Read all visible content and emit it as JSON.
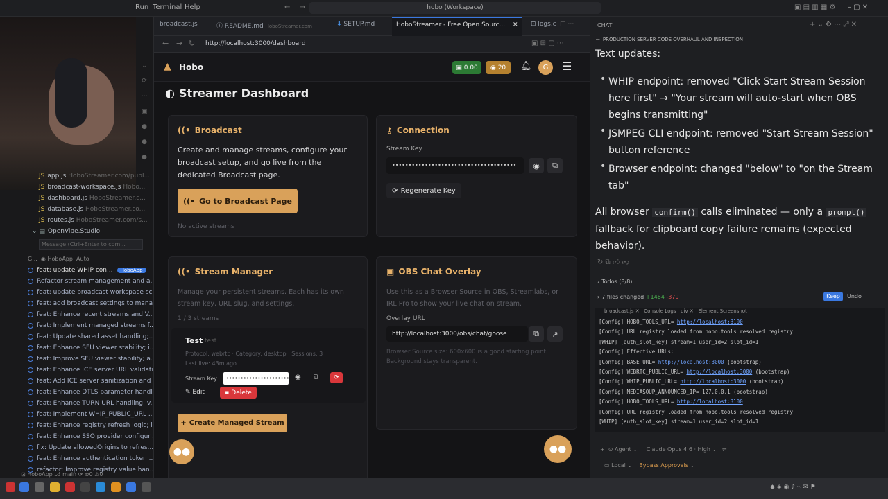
{
  "titlebar": {
    "menus": [
      "Run",
      "Terminal",
      "Help"
    ],
    "workspace": "hobo (Workspace)"
  },
  "explorer": {
    "files": [
      {
        "name": "app.js",
        "path": "HoboStreamer.com/publ..."
      },
      {
        "name": "broadcast-workspace.js",
        "path": "Hobo..."
      },
      {
        "name": "dashboard.js",
        "path": "HoboStreamer.c..."
      },
      {
        "name": "database.js",
        "path": "HoboStreamer.co..."
      },
      {
        "name": "routes.js",
        "path": "HoboStreamer.com/s..."
      }
    ],
    "repo": "OpenVibe.Studio",
    "message_placeholder": "Message (Ctrl+Enter to com...",
    "graph_label": "G...",
    "branch_label": "HoboApp",
    "auto_label": "Auto",
    "commits": [
      "feat: update WHIP con...",
      "Refactor stream management and a...",
      "feat: update broadcast workspace sc...",
      "feat: add broadcast settings to mana...",
      "feat: Enhance recent streams and V...",
      "feat: Implement managed streams f...",
      "feat: Update shared asset handling;...",
      "feat: Enhance SFU viewer stability; i...",
      "feat: Improve SFU viewer stability; a...",
      "feat: Enhance ICE server URL validati...",
      "feat: Add ICE server sanitization and ...",
      "feat: Enhance DTLS parameter handl...",
      "feat: Enhance TURN URL handling; v...",
      "feat: Implement WHIP_PUBLIC_URL ...",
      "feat: Enhance registry refresh logic; i...",
      "feat: Enhance SSO provider configur...",
      "fix: Update allowedOrigins to refres...",
      "feat: Enhance authentication token ...",
      "refactor: Improve registry value han..."
    ],
    "badge": "main"
  },
  "browser": {
    "tabs": [
      "broadcast.js",
      "README.md",
      "SETUP.md",
      "HoboStreamer - Free Open Sourc...",
      "logs.c"
    ],
    "tab_subs": [
      "",
      "HoboStreamer.com",
      "",
      ""
    ],
    "url": "http://localhost:3000/dashboard",
    "app": {
      "brand": "Hobo",
      "balance": "0.00",
      "coins": "20",
      "avatar_letter": "G",
      "page_title": "Streamer Dashboard",
      "broadcast": {
        "title": "Broadcast",
        "desc": "Create and manage streams, configure your broadcast setup, and go live from the dedicated Broadcast page.",
        "button": "Go to Broadcast Page",
        "empty": "No active streams"
      },
      "connection": {
        "title": "Connection",
        "key_label": "Stream Key",
        "key_value": "••••••••••••••••••••••••••••••••••••••",
        "regen": "Regenerate Key"
      },
      "manager": {
        "title": "Stream Manager",
        "desc": "Manage your persistent streams. Each has its own stream key, URL slug, and settings.",
        "count": "1 / 3 streams",
        "stream_name": "Test",
        "stream_sub": "test",
        "meta1": "Protocol: webrtc · Category: desktop · Sessions: 3",
        "meta2": "Last live: 43m ago",
        "key_label": "Stream Key:",
        "key_value": "••••••••••••••••••••••••••",
        "edit": "Edit",
        "delete": "Delete",
        "create": "Create Managed Stream"
      },
      "overlay": {
        "title": "OBS Chat Overlay",
        "desc": "Use this as a Browser Source in OBS, Streamlabs, or IRL Pro to show your live chat on stream.",
        "url_label": "Overlay URL",
        "url": "http://localhost:3000/obs/chat/goose",
        "note": "Browser Source size: 600x600 is a good starting point. Background stays transparent."
      }
    }
  },
  "chat": {
    "header": "CHAT",
    "session": "PRODUCTION SERVER CODE OVERHAUL AND INSPECTION",
    "heading": "Text updates:",
    "bullets": [
      "WHIP endpoint: removed \"Click Start Stream Session here first\" → \"Your stream will auto-start when OBS begins transmitting\"",
      "JSMPEG CLI endpoint: removed \"Start Stream Session\" button reference",
      "Browser endpoint: changed \"below\" to \"on the Stream tab\""
    ],
    "summary_pre": "All browser ",
    "summary_code1": "confirm()",
    "summary_mid": " calls eliminated — only a ",
    "summary_code2": "prompt()",
    "summary_post": " fallback for clipboard copy failure remains (expected behavior).",
    "todos": "Todos (8/8)",
    "files_changed": "7 files changed",
    "added": "+1464",
    "removed": "-379",
    "keep": "Keep",
    "undo": "Undo",
    "term_tabs": [
      "broadcast.js",
      "Console Logs",
      "div",
      "Element Screenshot"
    ],
    "logs": [
      [
        "[Config] HOBO_TOOLS_URL= ",
        "http://localhost:3100",
        ""
      ],
      [
        "[Config] URL registry loaded from hobo.tools resolved registry",
        "",
        ""
      ],
      [
        "[WHIP] [auth_slot_key] stream=1 user_id=2 slot_id=1",
        "",
        ""
      ],
      [
        "[Config] Effective URLs:",
        "",
        ""
      ],
      [
        "[Config]   BASE_URL= ",
        "http://localhost:3000",
        " (bootstrap)"
      ],
      [
        "[Config]   WEBRTC_PUBLIC_URL= ",
        "http://localhost:3000",
        " (bootstrap)"
      ],
      [
        "[Config]   WHIP_PUBLIC_URL= ",
        "http://localhost:3000",
        " (bootstrap)"
      ],
      [
        "[Config]   MEDIASOUP_ANNOUNCED_IP= 127.0.0.1 (bootstrap)",
        "",
        ""
      ],
      [
        "[Config]   HOBO_TOOLS_URL= ",
        "http://localhost:3100",
        ""
      ],
      [
        "[Config] URL registry loaded from hobo.tools resolved registry",
        "",
        ""
      ],
      [
        "[WHIP] [auth_slot_key] stream=1 user_id=2 slot_id=1",
        "",
        ""
      ]
    ],
    "agent": "Agent",
    "model": "Claude Opus 4.6 · High",
    "local": "Local",
    "approvals": "Bypass Approvals"
  },
  "colors": {
    "accent": "#d9a15a",
    "link": "#6fa3ff",
    "danger": "#d9373b"
  }
}
